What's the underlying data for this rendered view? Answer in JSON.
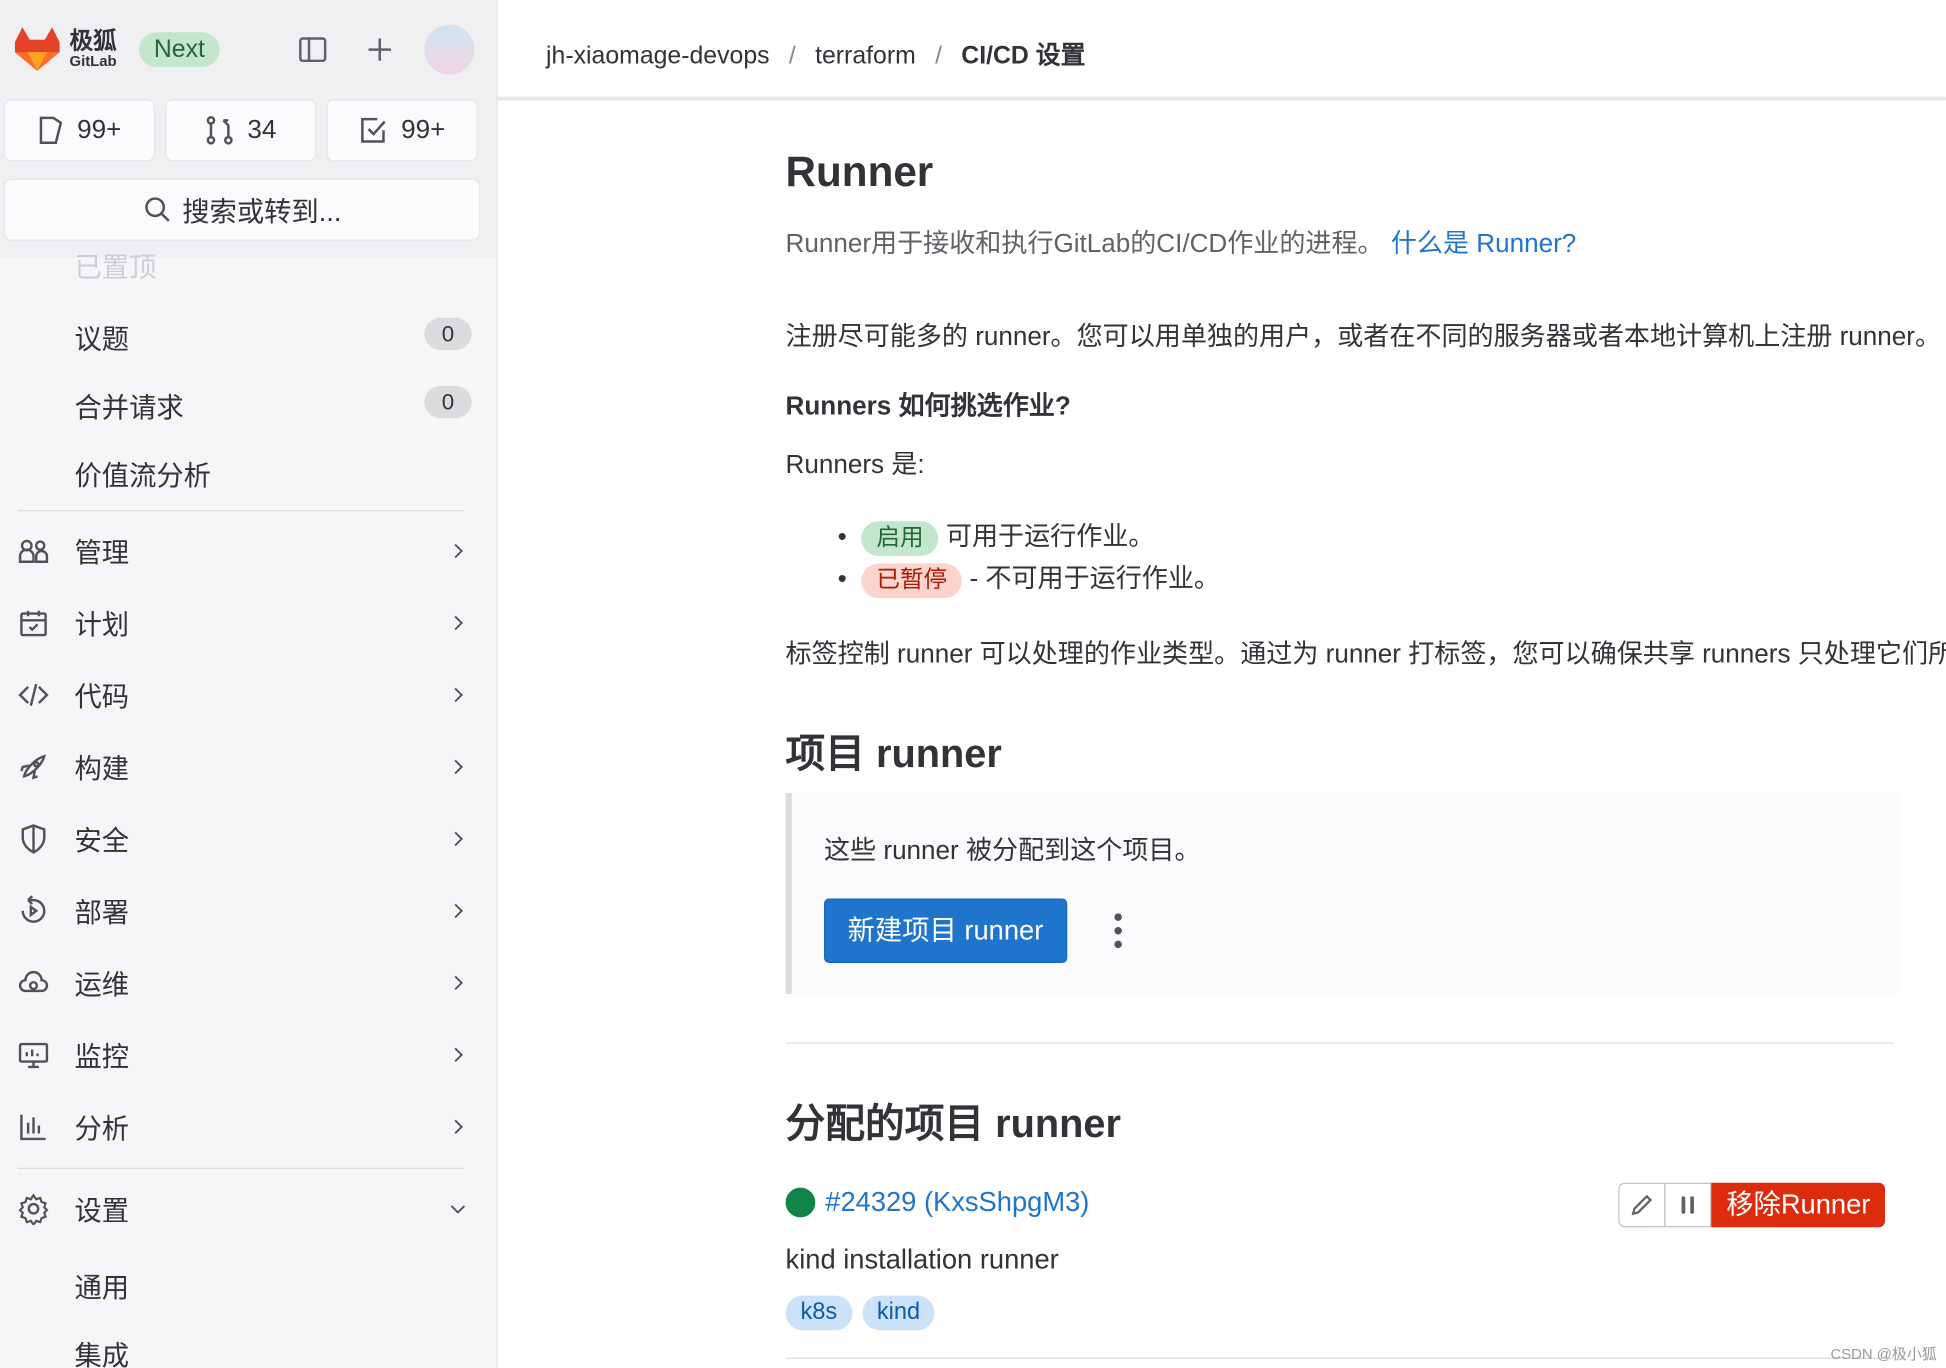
{
  "brand": {
    "name_cn": "极狐",
    "name_en": "GitLab",
    "badge": "Next"
  },
  "counters": [
    {
      "icon": "issues-icon",
      "value": "99+"
    },
    {
      "icon": "merge-request-icon",
      "value": "34"
    },
    {
      "icon": "todo-icon",
      "value": "99+"
    }
  ],
  "search": {
    "placeholder": "搜索或转到..."
  },
  "sidebar": {
    "faded_item": "已置顶",
    "pinned": [
      {
        "label": "议题",
        "count": "0"
      },
      {
        "label": "合并请求",
        "count": "0"
      },
      {
        "label": "价值流分析"
      }
    ],
    "groups": [
      {
        "label": "管理",
        "icon": "users-icon"
      },
      {
        "label": "计划",
        "icon": "calendar-icon"
      },
      {
        "label": "代码",
        "icon": "code-icon"
      },
      {
        "label": "构建",
        "icon": "rocket-icon"
      },
      {
        "label": "安全",
        "icon": "shield-icon"
      },
      {
        "label": "部署",
        "icon": "deploy-icon"
      },
      {
        "label": "运维",
        "icon": "cloud-icon"
      },
      {
        "label": "监控",
        "icon": "monitor-icon"
      },
      {
        "label": "分析",
        "icon": "chart-icon"
      }
    ],
    "settings": {
      "label": "设置",
      "children": [
        "通用",
        "集成"
      ]
    }
  },
  "breadcrumb": [
    "jh-xiaomage-devops",
    "terraform",
    "CI/CD 设置"
  ],
  "main": {
    "title": "Runner",
    "description": "Runner用于接收和执行GitLab的CI/CD作业的进程。",
    "help_link": "什么是 Runner?",
    "register_text": "注册尽可能多的 runner。您可以用单独的用户，或者在不同的服务器或者本地计算机上注册 runner。",
    "how_title": "Runners 如何挑选作业?",
    "runners_are": "Runners 是:",
    "states": [
      {
        "badge": "启用",
        "text": "可用于运行作业。"
      },
      {
        "badge": "已暂停",
        "text": "- 不可用于运行作业。"
      }
    ],
    "tags_text": "标签控制 runner 可以处理的作业类型。通过为 runner 打标签，您可以确保共享 runners 只处理它们所具备的作业。",
    "project_title": "项目 runner",
    "project_desc": "这些 runner 被分配到这个项目。",
    "new_button": "新建项目 runner",
    "assigned_title": "分配的项目 runner",
    "runner": {
      "id": "#24329 (KxsShpgM3)",
      "description": "kind installation runner",
      "tags": [
        "k8s",
        "kind"
      ],
      "status_color": "#108548",
      "remove_label": "移除Runner"
    }
  },
  "watermark": "CSDN @极小狐",
  "colors": {
    "primary": "#1f75cb",
    "danger": "#dd2b0e",
    "link": "#1f75cb",
    "success_bg": "#c3e6cd",
    "paused_bg": "#fdd4cd"
  }
}
